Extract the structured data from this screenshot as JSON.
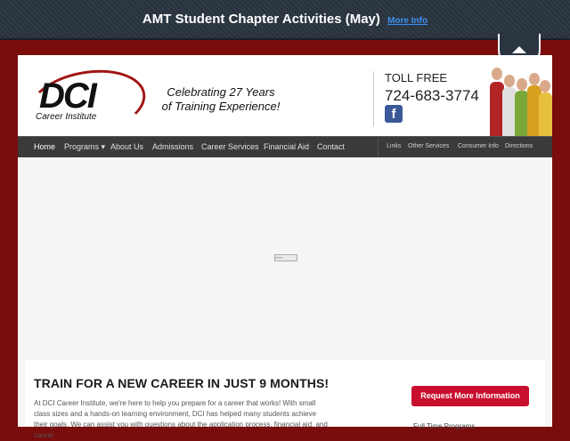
{
  "announcement": {
    "text": "AMT Student Chapter Activities (May)",
    "link": "More Info"
  },
  "header": {
    "logo_main": "DCI",
    "logo_sub": "Career Institute",
    "tagline_line1": "Celebrating 27 Years",
    "tagline_line2": "of Training Experience!",
    "toll_free_label": "TOLL FREE",
    "phone": "724-683-3774",
    "facebook_glyph": "f"
  },
  "nav": {
    "items": [
      "Home",
      "Programs ▾",
      "About Us",
      "Admissions",
      "Career Services",
      "Financial Aid",
      "Contact"
    ],
    "secondary": [
      "Links",
      "Other Services",
      "Consumer Info",
      "Directions"
    ]
  },
  "slider": {
    "loader_text": "▫▫▫▫▫▫"
  },
  "main": {
    "headline": "TRAIN FOR A NEW CAREER IN JUST 9 MONTHS!",
    "paragraph": "At DCI Career Institute, we're here to help you prepare for a career that works! With small class sizes and a hands-on learning environment, DCI has helped many students achieve their goals. We can assist you with questions about the application process, financial aid, and career",
    "cta": "Request More Information",
    "sidebar_heading": "Full Time Programs"
  },
  "colors": {
    "background": "#7a0c0c",
    "topbar": "#2a3540",
    "accent_red": "#c8102e",
    "link_blue": "#3b8ff0",
    "nav_bg": "#3a3a3a"
  },
  "icons": {
    "scroll_top": "triangle-up-icon",
    "facebook": "facebook-icon"
  }
}
